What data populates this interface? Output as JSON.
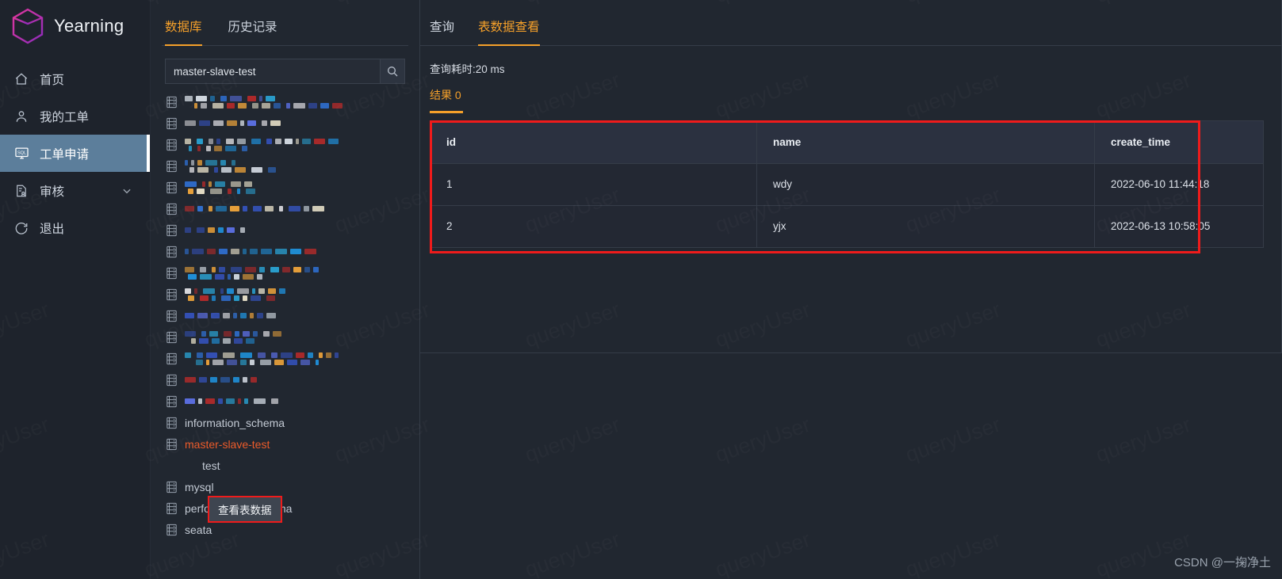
{
  "app": {
    "brand": "Yearning",
    "logo_color": "#c6268f"
  },
  "sidebar": {
    "items": [
      {
        "label": "首页",
        "icon": "home-icon",
        "active": false,
        "expandable": false
      },
      {
        "label": "我的工单",
        "icon": "user-icon",
        "active": false,
        "expandable": false
      },
      {
        "label": "工单申请",
        "icon": "sql-monitor-icon",
        "active": true,
        "expandable": false
      },
      {
        "label": "审核",
        "icon": "audit-icon",
        "active": false,
        "expandable": true
      },
      {
        "label": "退出",
        "icon": "logout-icon",
        "active": false,
        "expandable": false
      }
    ]
  },
  "db_panel": {
    "tabs": [
      {
        "label": "数据库",
        "active": true
      },
      {
        "label": "历史记录",
        "active": false
      }
    ],
    "search": {
      "value": "master-slave-test",
      "placeholder": "",
      "icon": "search-icon"
    },
    "databases": [
      {
        "label": "",
        "redacted": true,
        "selected": false,
        "child": false
      },
      {
        "label": "",
        "redacted": true,
        "selected": false,
        "child": false
      },
      {
        "label": "",
        "redacted": true,
        "selected": false,
        "child": false
      },
      {
        "label": "",
        "redacted": true,
        "selected": false,
        "child": false
      },
      {
        "label": "",
        "redacted": true,
        "selected": false,
        "child": false
      },
      {
        "label": "",
        "redacted": true,
        "selected": false,
        "child": false
      },
      {
        "label": "",
        "redacted": true,
        "selected": false,
        "child": false
      },
      {
        "label": "",
        "redacted": true,
        "selected": false,
        "child": false
      },
      {
        "label": "",
        "redacted": true,
        "selected": false,
        "child": false
      },
      {
        "label": "",
        "redacted": true,
        "selected": false,
        "child": false
      },
      {
        "label": "",
        "redacted": true,
        "selected": false,
        "child": false
      },
      {
        "label": "",
        "redacted": true,
        "selected": false,
        "child": false
      },
      {
        "label": "",
        "redacted": true,
        "selected": false,
        "child": false
      },
      {
        "label": "",
        "redacted": true,
        "selected": false,
        "child": false
      },
      {
        "label": "",
        "redacted": true,
        "selected": false,
        "child": false
      },
      {
        "label": "information_schema",
        "redacted": false,
        "selected": false,
        "child": false
      },
      {
        "label": "master-slave-test",
        "redacted": false,
        "selected": true,
        "child": false
      },
      {
        "label": "test",
        "redacted": false,
        "selected": false,
        "child": true
      },
      {
        "label": "mysql",
        "redacted": false,
        "selected": false,
        "child": false
      },
      {
        "label": "performance_schema",
        "redacted": false,
        "selected": false,
        "child": false
      },
      {
        "label": "seata",
        "redacted": false,
        "selected": false,
        "child": false
      }
    ],
    "tooltip": {
      "label": "查看表数据",
      "border_color": "#ef1b1b"
    }
  },
  "main": {
    "tabs": [
      {
        "label": "查询",
        "active": false
      },
      {
        "label": "表数据查看",
        "active": true
      }
    ],
    "query_cost": "查询耗时:20 ms",
    "result_tab": "结果 0",
    "accent_color": "#f5a02a",
    "highlight_color": "#ef1b1b",
    "table": {
      "columns": [
        "id",
        "name",
        "create_time"
      ],
      "rows": [
        [
          "1",
          "wdy",
          "2022-06-10 11:44:18"
        ],
        [
          "2",
          "yjx",
          "2022-06-13 10:58:05"
        ]
      ]
    }
  },
  "watermark": {
    "text": "queryUser",
    "credit": "CSDN @一掬净土"
  }
}
